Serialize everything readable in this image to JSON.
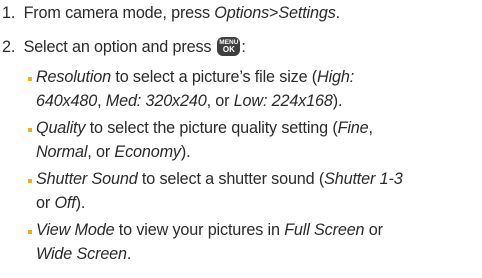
{
  "colors": {
    "text": "#2a2a2a",
    "bullet": "#f0b400",
    "key_bg": "#3f3f3f"
  },
  "step1": {
    "number": "1.",
    "text_a": "From camera mode, press ",
    "path_a": "Options",
    "separator": ">",
    "path_b": "Settings",
    "text_end": "."
  },
  "step2": {
    "number": "2.",
    "text_a": "Select an option and press",
    "key_icon": "menu-ok-key-icon",
    "key_top": "MENU",
    "key_bottom": "OK",
    "text_end": ":"
  },
  "options": [
    {
      "name": "Resolution",
      "desc": " to select a picture’s file size (",
      "v1": "High:",
      "v1b": "640x480",
      "s1": ", ",
      "v2": "Med: 320x240",
      "s2": ", or ",
      "v3": "Low: 224x168",
      "end": ")."
    },
    {
      "name": "Quality",
      "desc": " to select the picture quality setting (",
      "v1": "Fine",
      "s1": ",",
      "v2": "Normal",
      "s2": ", or ",
      "v3": "Economy",
      "end": ")."
    },
    {
      "name": "Shutter Sound",
      "desc": " to select a shutter sound (",
      "v1": "Shutter 1-3",
      "s1": "or ",
      "v2": "Off",
      "end": ")."
    },
    {
      "name": "View Mode",
      "desc": " to view your pictures in ",
      "v1": "Full Screen",
      "s1": " or",
      "v2": "Wide Screen",
      "end": "."
    }
  ]
}
